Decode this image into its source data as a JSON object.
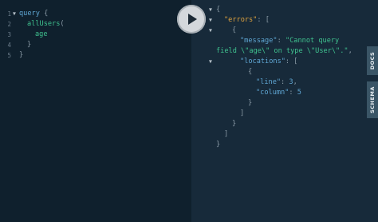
{
  "query_editor": {
    "line_numbers": [
      "1",
      "2",
      "3",
      "4",
      "5"
    ],
    "tokens": {
      "query_keyword": "query",
      "open_brace": "{",
      "field_all_users": "allUsers",
      "open_paren": "(",
      "field_age": "age",
      "close_brace_inner": "}",
      "close_brace_outer": "}"
    }
  },
  "run_button": {
    "icon": "play-icon"
  },
  "result_viewer": {
    "open_brace": "{",
    "errors_key": "\"errors\"",
    "colon": ":",
    "open_bracket": "[",
    "obj_open": "{",
    "message_key": "\"message\"",
    "message_value_part1": "\"Cannot query",
    "message_value_part2": "field \\\"age\\\" on type \\\"User\\\".\"",
    "comma": ",",
    "locations_key": "\"locations\"",
    "loc_open_bracket": "[",
    "loc_obj_open": "{",
    "line_key": "\"line\"",
    "line_value": "3",
    "column_key": "\"column\"",
    "column_value": "5",
    "loc_obj_close": "}",
    "loc_close_bracket": "]",
    "obj_close": "}",
    "close_bracket": "]",
    "close_brace": "}"
  },
  "side_tabs": {
    "docs": "DOCS",
    "schema": "SCHEMA"
  },
  "colors": {
    "editor_bg": "#0f202d",
    "result_bg": "#172a3a",
    "keyword": "#5fa6d3",
    "field": "#3fc28f",
    "errors_key": "#e0a33d",
    "side_tab_bg": "#3a5566"
  }
}
